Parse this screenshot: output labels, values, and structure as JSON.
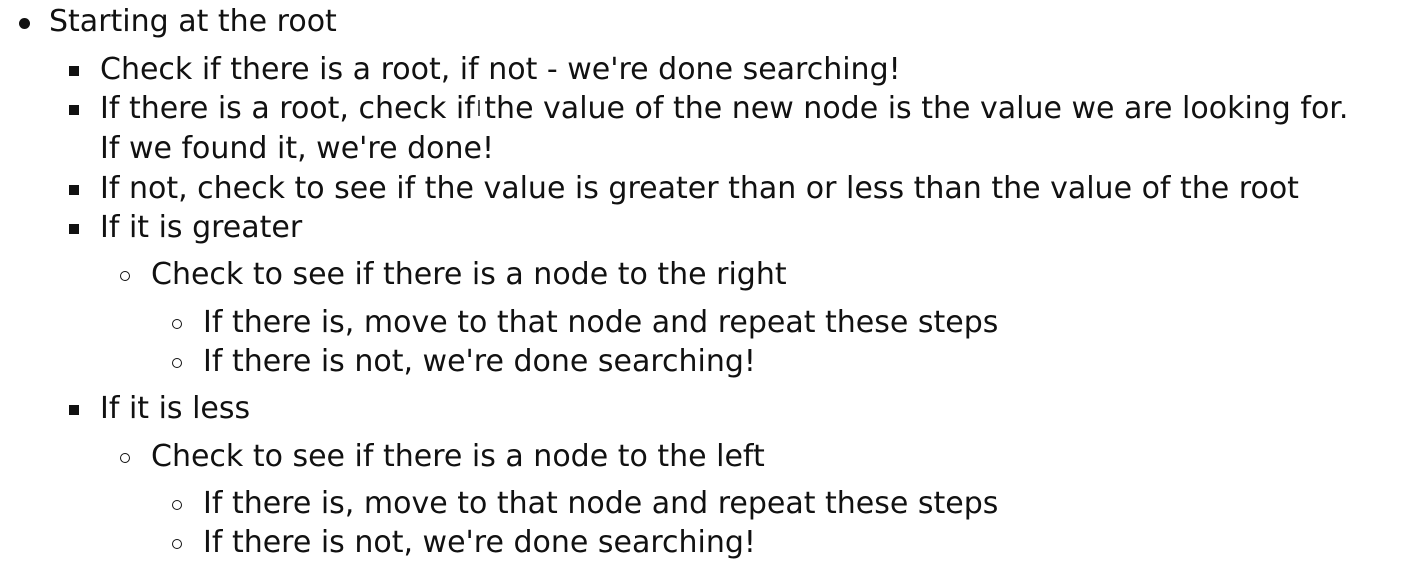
{
  "outline": {
    "root_item": "Starting at the root",
    "level2": {
      "check_root": "Check if there is a root, if not - we're done searching!",
      "compare_value_line1": "If there is a root, check if the value of the new node is the value we are looking for.",
      "compare_value_line2": "If we found it, we're done!",
      "check_greater_less": "If not, check to see if the value is greater than or less than the value of the root",
      "greater": "If it is greater",
      "less": "If it is less"
    },
    "greater_branch": {
      "check_right": "Check to see if there is a node to the right",
      "if_there_is": "If there is, move to that node and repeat these steps",
      "if_not": "If there is not, we're done searching!"
    },
    "less_branch": {
      "check_left": "Check to see if there is a node to the left",
      "if_there_is": "If there is, move to that node and repeat these steps",
      "if_not": "If there is not, we're done searching!"
    }
  }
}
